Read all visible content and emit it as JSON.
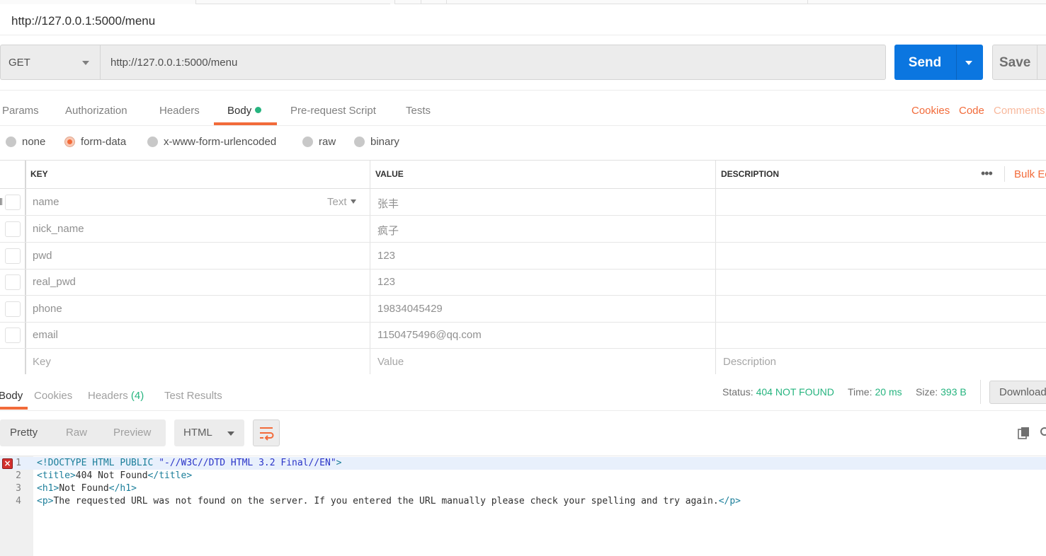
{
  "request": {
    "title": "http://127.0.0.1:5000/menu",
    "method": "GET",
    "url": "http://127.0.0.1:5000/menu",
    "send_label": "Send",
    "save_label": "Save"
  },
  "request_tabs": [
    "Params",
    "Authorization",
    "Headers",
    "Body",
    "Pre-request Script",
    "Tests"
  ],
  "right_links": {
    "cookies": "Cookies",
    "code": "Code",
    "comments": "Comments"
  },
  "body_modes": [
    "none",
    "form-data",
    "x-www-form-urlencoded",
    "raw",
    "binary"
  ],
  "body_mode_selected": "form-data",
  "table": {
    "headers": {
      "key": "KEY",
      "value": "VALUE",
      "description": "DESCRIPTION"
    },
    "bulk_edit": "Bulk Edit",
    "type_label": "Text",
    "rows": [
      {
        "key": "name",
        "value": "张丰"
      },
      {
        "key": "nick_name",
        "value": "疯子"
      },
      {
        "key": "pwd",
        "value": "123"
      },
      {
        "key": "real_pwd",
        "value": "123"
      },
      {
        "key": "phone",
        "value": "19834045429"
      },
      {
        "key": "email",
        "value": "1150475496@qq.com"
      }
    ],
    "placeholders": {
      "key": "Key",
      "value": "Value",
      "description": "Description"
    }
  },
  "response": {
    "tabs": {
      "body": "Body",
      "cookies": "Cookies",
      "headers": "Headers",
      "headers_count": "(4)",
      "test_results": "Test Results"
    },
    "status_label": "Status:",
    "status_value": "404 NOT FOUND",
    "time_label": "Time:",
    "time_value": "20 ms",
    "size_label": "Size:",
    "size_value": "393 B",
    "download_label": "Download",
    "views": [
      "Pretty",
      "Raw",
      "Preview"
    ],
    "language": "HTML"
  },
  "code_lines": {
    "l1_doctype": "<!DOCTYPE HTML PUBLIC ",
    "l1_string": "\"-//W3C//DTD HTML 3.2 Final//EN\"",
    "l1_close": ">",
    "l2_open": "<title>",
    "l2_text": "404 Not Found",
    "l2_close": "</title>",
    "l3_open": "<h1>",
    "l3_text": "Not Found",
    "l3_close": "</h1>",
    "l4_open": "<p>",
    "l4_text": "The requested URL was not found on the server. If you entered the URL manually please check your spelling and try again.",
    "l4_close": "</p>"
  },
  "line_numbers": [
    "1",
    "2",
    "3",
    "4"
  ],
  "colors": {
    "accent": "#f26b3a",
    "send": "#0b76e0",
    "success": "#26b47f"
  }
}
